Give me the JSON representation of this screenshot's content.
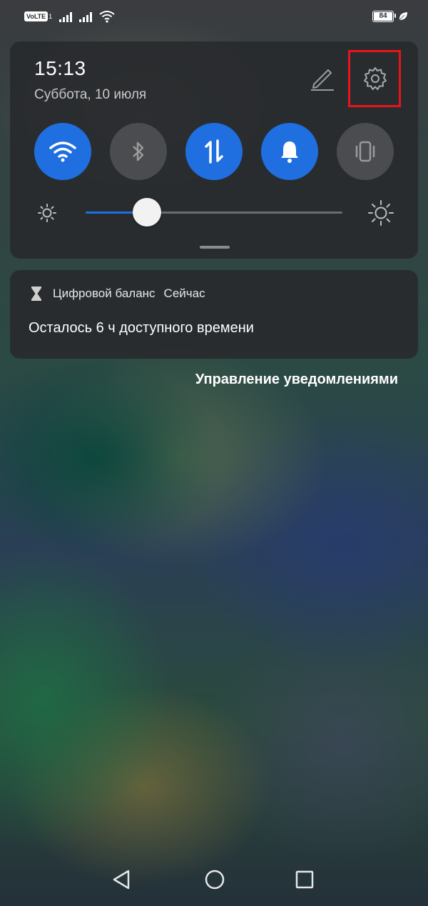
{
  "status_bar": {
    "volte_label": "VoLTE",
    "volte_sim": "1",
    "battery_level": "84",
    "icons": [
      "volte-icon",
      "signal-icon",
      "signal-icon",
      "wifi-icon",
      "battery-icon",
      "leaf-icon"
    ]
  },
  "quick_settings": {
    "time": "15:13",
    "date": "Суббота, 10 июля",
    "edit_icon": "pencil-icon",
    "settings_icon": "gear-icon",
    "toggles": [
      {
        "icon": "wifi-icon",
        "state": "on"
      },
      {
        "icon": "bluetooth-icon",
        "state": "off"
      },
      {
        "icon": "mobile-data-icon",
        "state": "on"
      },
      {
        "icon": "bell-icon",
        "state": "on"
      },
      {
        "icon": "vibrate-icon",
        "state": "off"
      }
    ],
    "brightness_level": 0.24
  },
  "notification": {
    "app_icon": "hourglass-icon",
    "app_name": "Цифровой баланс",
    "time": "Сейчас",
    "text": "Осталось 6 ч доступного времени"
  },
  "manage_link": "Управление уведомлениями",
  "navigation": {
    "icons": [
      "back-icon",
      "home-icon",
      "recents-icon"
    ]
  },
  "colors": {
    "accent": "#1f6fe0",
    "highlight": "#e8141b",
    "panel": "#2a2c30"
  }
}
